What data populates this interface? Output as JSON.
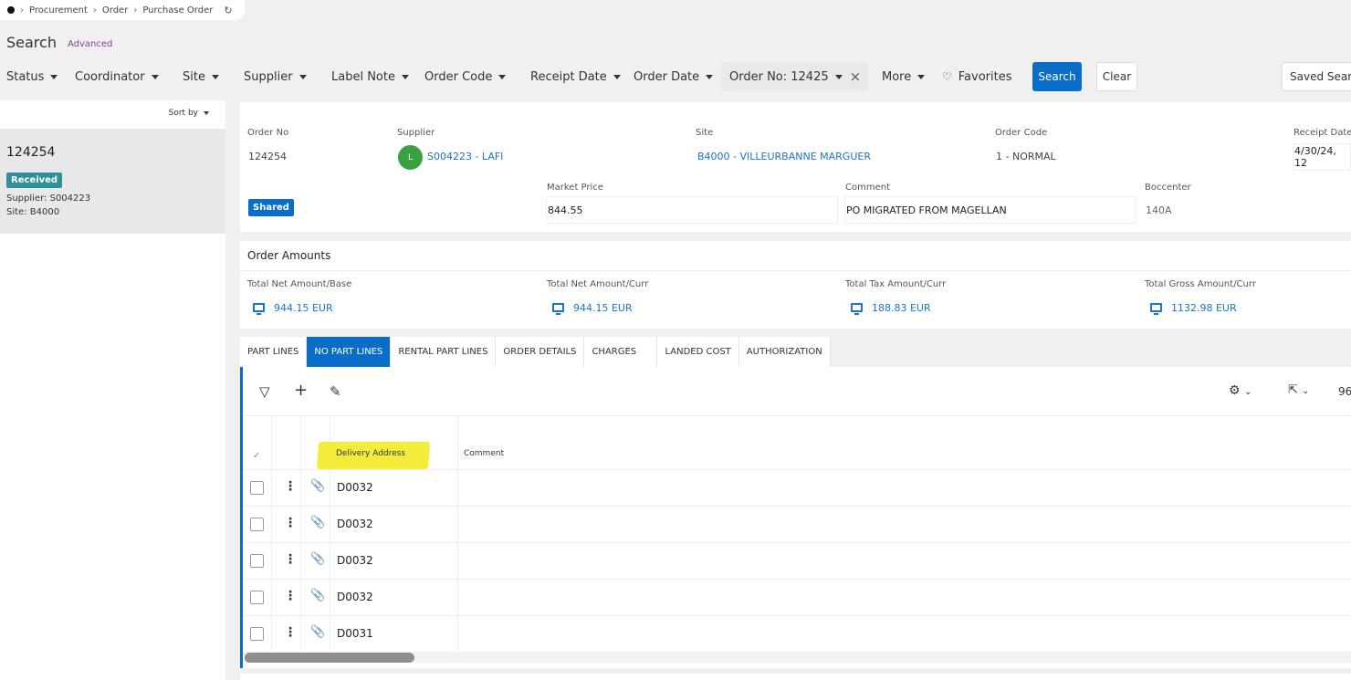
{
  "breadcrumb": {
    "items": [
      "Procurement",
      "Order",
      "Purchase Order"
    ]
  },
  "search": {
    "title": "Search",
    "advanced_label": "Advanced"
  },
  "filters": {
    "status": "Status",
    "coordinator": "Coordinator",
    "site": "Site",
    "supplier": "Supplier",
    "label_note": "Label Note",
    "order_code": "Order Code",
    "receipt_date": "Receipt Date",
    "order_date": "Order Date",
    "order_no": "Order No: 12425",
    "more": "More",
    "favorites": "Favorites",
    "search_button": "Search",
    "clear_button": "Clear",
    "saved_searches": "Saved Searches"
  },
  "left_panel": {
    "sort_by": "Sort by",
    "card": {
      "order_no": "124254",
      "status": "Received",
      "supplier_label": "Supplier:",
      "supplier_value": "S004223",
      "site_label": "Site:",
      "site_value": "B4000"
    }
  },
  "header": {
    "order_no_label": "Order No",
    "order_no": "124254",
    "supplier_label": "Supplier",
    "supplier_avatar": "L",
    "supplier": "S004223 - LAFI",
    "site_label": "Site",
    "site": "B4000 - VILLEURBANNE MARGUER",
    "order_code_label": "Order Code",
    "order_code": "1 - NORMAL",
    "receipt_date_label": "Receipt Date",
    "receipt_date": "4/30/24, 12",
    "shared_badge": "Shared",
    "market_price_label": "Market Price",
    "market_price": "844.55",
    "comment_label": "Comment",
    "comment": "PO MIGRATED FROM MAGELLAN",
    "boccenter_label": "Boccenter",
    "boccenter": "140A"
  },
  "amounts": {
    "title": "Order Amounts",
    "total_net_base_label": "Total Net Amount/Base",
    "total_net_base": "944.15 EUR",
    "total_net_curr_label": "Total Net Amount/Curr",
    "total_net_curr": "944.15 EUR",
    "total_tax_curr_label": "Total Tax Amount/Curr",
    "total_tax_curr": "188.83 EUR",
    "total_gross_curr_label": "Total Gross Amount/Curr",
    "total_gross_curr": "1132.98 EUR"
  },
  "tabs": {
    "part_lines": "PART LINES",
    "no_part_lines": "NO PART LINES",
    "rental_part_lines": "RENTAL PART LINES",
    "order_details": "ORDER DETAILS",
    "charges": "CHARGES",
    "landed_cost": "LANDED COST",
    "authorization": "AUTHORIZATION"
  },
  "grid": {
    "count": "96",
    "columns": {
      "delivery_address": "Delivery Address",
      "comment": "Comment"
    },
    "rows": [
      {
        "delivery_address": "D0032"
      },
      {
        "delivery_address": "D0032"
      },
      {
        "delivery_address": "D0032"
      },
      {
        "delivery_address": "D0032"
      },
      {
        "delivery_address": "D0031"
      }
    ]
  },
  "colors": {
    "accent": "#0a6dc8",
    "received": "#2f8f9a",
    "supplier_avatar": "#3aa140",
    "highlight": "#f4ec3a"
  }
}
